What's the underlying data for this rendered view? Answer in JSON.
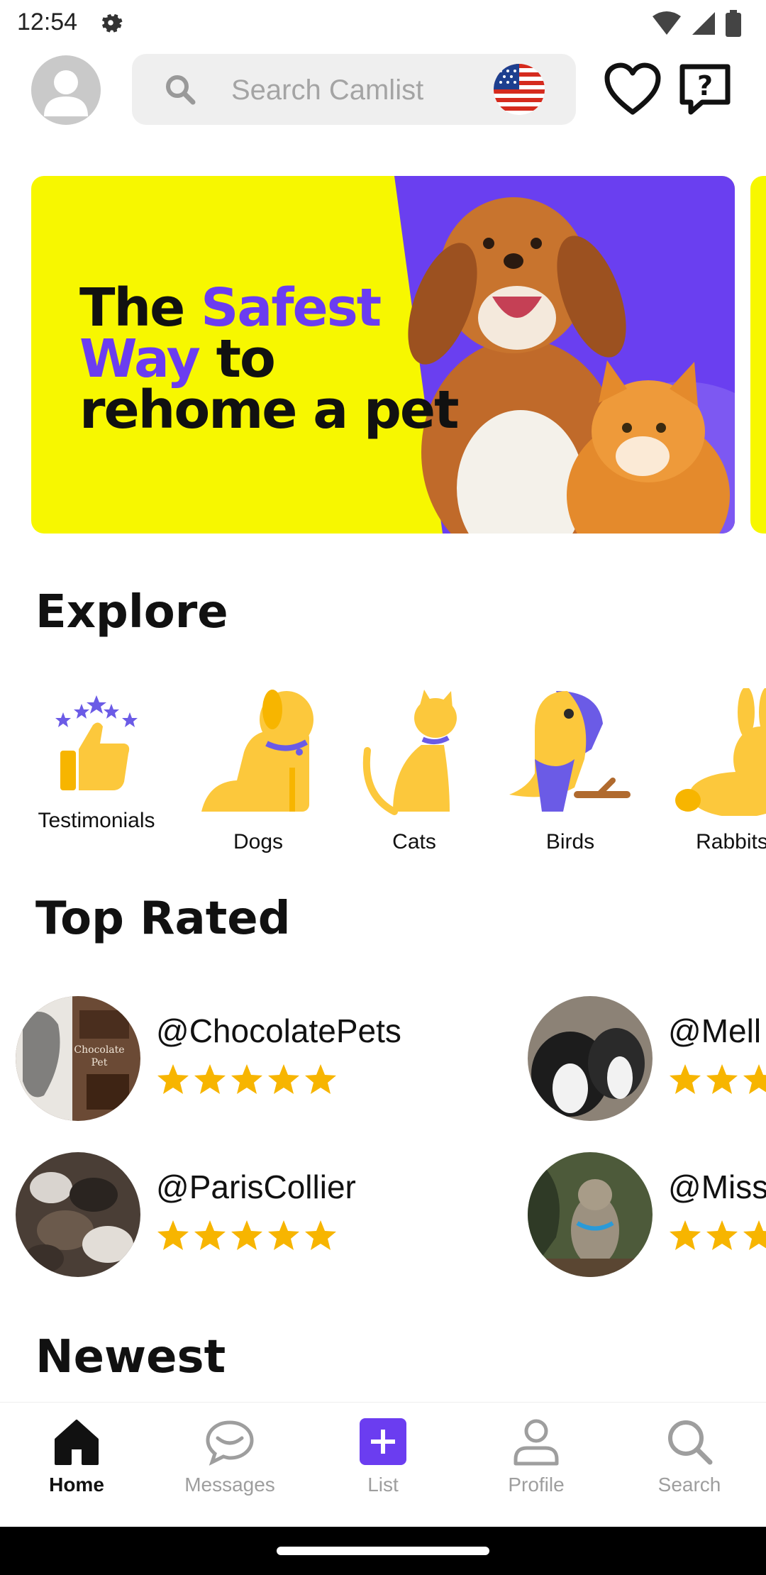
{
  "status_bar": {
    "time": "12:54"
  },
  "header": {
    "search_placeholder": "Search Camlist",
    "favorites_icon": "heart-icon",
    "help_icon": "help-chat-icon"
  },
  "banner": {
    "line1_a": "The ",
    "line1_b": "Safest",
    "line2_a": "Way",
    "line2_b": " to",
    "line3": "rehome a pet"
  },
  "explore": {
    "title": "Explore",
    "categories": [
      {
        "label": "Testimonials",
        "icon": "thumbs-up-icon"
      },
      {
        "label": "Dogs",
        "icon": "dog-icon"
      },
      {
        "label": "Cats",
        "icon": "cat-icon"
      },
      {
        "label": "Birds",
        "icon": "bird-icon"
      },
      {
        "label": "Rabbits",
        "icon": "rabbit-icon"
      }
    ]
  },
  "top_rated": {
    "title": "Top Rated",
    "sellers": [
      {
        "handle": "@ChocolatePets",
        "rating": 5
      },
      {
        "handle": "@Mell",
        "rating": 5
      },
      {
        "handle": "@ParisCollier",
        "rating": 5
      },
      {
        "handle": "@Miss",
        "rating": 5
      }
    ]
  },
  "newest": {
    "title": "Newest"
  },
  "bottom_nav": {
    "items": [
      {
        "label": "Home",
        "icon": "home-icon",
        "active": true
      },
      {
        "label": "Messages",
        "icon": "messages-icon",
        "active": false
      },
      {
        "label": "List",
        "icon": "add-listing-icon",
        "active": false
      },
      {
        "label": "Profile",
        "icon": "profile-icon",
        "active": false
      },
      {
        "label": "Search",
        "icon": "search-icon",
        "active": false
      }
    ]
  },
  "colors": {
    "accent": "#6b3df0",
    "yellow": "#f7f700",
    "icon_yellow": "#fcc83c",
    "star": "#f7b500"
  }
}
